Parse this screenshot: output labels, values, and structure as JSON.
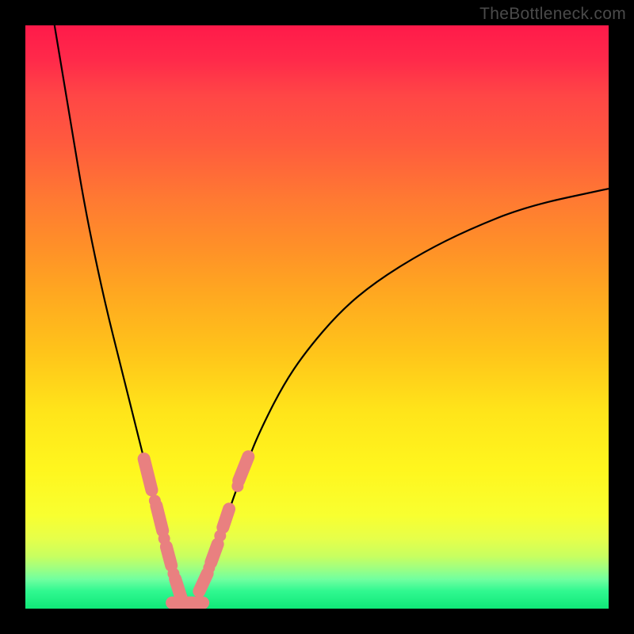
{
  "watermark": "TheBottleneck.com",
  "chart_data": {
    "type": "line",
    "title": "",
    "xlabel": "",
    "ylabel": "",
    "xlim": [
      0,
      100
    ],
    "ylim": [
      0,
      100
    ],
    "description": "V-shaped bottleneck curve on a vertical red→green gradient. Minimum (green zone) around x≈26–30. Left branch rises steeply to 100 near x≈5; right branch rises more gradually to ≈72 at x=100. Pink markers sit near the trough on both branches.",
    "curve": [
      {
        "x": 5,
        "y": 100
      },
      {
        "x": 6,
        "y": 94
      },
      {
        "x": 8,
        "y": 82
      },
      {
        "x": 10,
        "y": 70
      },
      {
        "x": 12,
        "y": 60
      },
      {
        "x": 14,
        "y": 51
      },
      {
        "x": 16,
        "y": 43
      },
      {
        "x": 18,
        "y": 35
      },
      {
        "x": 20,
        "y": 27
      },
      {
        "x": 22,
        "y": 19
      },
      {
        "x": 24,
        "y": 11
      },
      {
        "x": 26,
        "y": 4
      },
      {
        "x": 27,
        "y": 1.5
      },
      {
        "x": 28,
        "y": 1
      },
      {
        "x": 29,
        "y": 1.5
      },
      {
        "x": 30,
        "y": 3
      },
      {
        "x": 32,
        "y": 8
      },
      {
        "x": 34,
        "y": 14
      },
      {
        "x": 36,
        "y": 20
      },
      {
        "x": 38,
        "y": 25
      },
      {
        "x": 40,
        "y": 30
      },
      {
        "x": 44,
        "y": 38
      },
      {
        "x": 48,
        "y": 44
      },
      {
        "x": 54,
        "y": 51
      },
      {
        "x": 60,
        "y": 56
      },
      {
        "x": 68,
        "y": 61
      },
      {
        "x": 76,
        "y": 65
      },
      {
        "x": 86,
        "y": 69
      },
      {
        "x": 100,
        "y": 72
      }
    ],
    "markers_left": [
      {
        "x": 21.0,
        "y": 23.0,
        "kind": "pill",
        "len": 3.5
      },
      {
        "x": 22.2,
        "y": 18.5,
        "kind": "dot"
      },
      {
        "x": 23.0,
        "y": 15.5,
        "kind": "pill",
        "len": 3.0
      },
      {
        "x": 23.8,
        "y": 12.0,
        "kind": "dot"
      },
      {
        "x": 24.6,
        "y": 9.0,
        "kind": "pill",
        "len": 2.5
      },
      {
        "x": 25.4,
        "y": 6.0,
        "kind": "dot"
      },
      {
        "x": 26.2,
        "y": 3.5,
        "kind": "pill",
        "len": 2.5
      },
      {
        "x": 27.8,
        "y": 1.0,
        "kind": "pill",
        "len": 3.4,
        "horizontal": true
      }
    ],
    "markers_right": [
      {
        "x": 30.5,
        "y": 4.5,
        "kind": "pill",
        "len": 2.5
      },
      {
        "x": 31.5,
        "y": 7.0,
        "kind": "dot"
      },
      {
        "x": 32.4,
        "y": 9.5,
        "kind": "pill",
        "len": 2.5
      },
      {
        "x": 33.4,
        "y": 12.5,
        "kind": "dot"
      },
      {
        "x": 34.4,
        "y": 15.5,
        "kind": "pill",
        "len": 2.5
      },
      {
        "x": 36.4,
        "y": 21.0,
        "kind": "dot"
      },
      {
        "x": 37.4,
        "y": 24.0,
        "kind": "pill",
        "len": 3.0
      }
    ]
  }
}
